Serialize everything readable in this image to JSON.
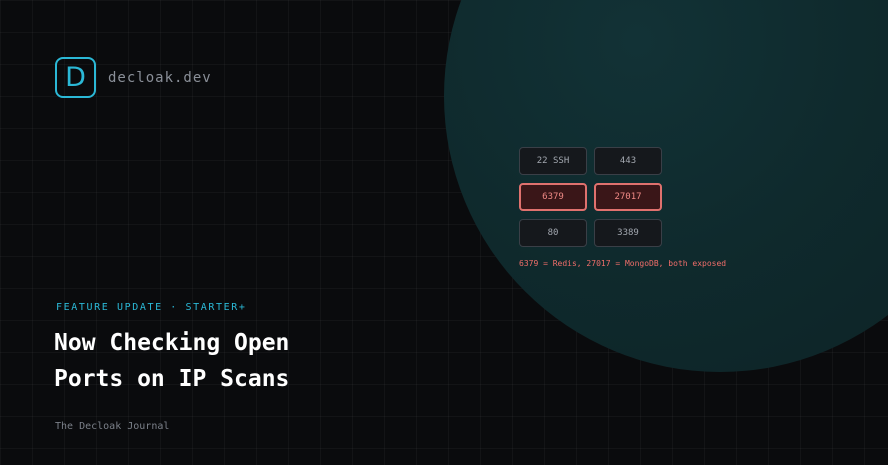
{
  "brand": {
    "logo_letter": "D",
    "name": "decloak.dev",
    "accent_color": "#2bb8d6"
  },
  "ports": {
    "items": [
      {
        "label": "22 SSH",
        "exposed": false
      },
      {
        "label": "443",
        "exposed": false
      },
      {
        "label": "6379",
        "exposed": true
      },
      {
        "label": "27017",
        "exposed": true
      },
      {
        "label": "80",
        "exposed": false
      },
      {
        "label": "3389",
        "exposed": false
      }
    ],
    "note": "6379 = Redis, 27017 = MongoDB, both exposed",
    "exposed_color": "#e0716e"
  },
  "article": {
    "eyebrow": "FEATURE UPDATE · STARTER+",
    "headline_line1": "Now Checking Open",
    "headline_line2": "Ports on IP Scans",
    "publication": "The Decloak Journal"
  }
}
